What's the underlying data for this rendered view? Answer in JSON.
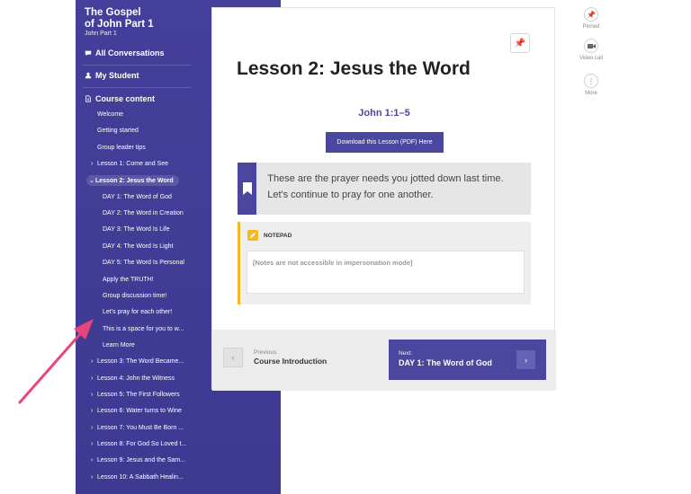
{
  "sidebar": {
    "course_title_line1": "The Gospel",
    "course_title_line2": "of John Part 1",
    "course_subtitle": "John Part 1",
    "all_conversations": "All Conversations",
    "my_student": "My Student",
    "course_content": "Course content",
    "items": [
      {
        "label": "Welcome",
        "chev": ""
      },
      {
        "label": "Getting started",
        "chev": ""
      },
      {
        "label": "Group leader tips",
        "chev": ""
      },
      {
        "label": "Lesson 1: Come and See",
        "chev": "›"
      },
      {
        "label": "Lesson 2: Jesus the Word",
        "chev": "⌄"
      },
      {
        "label": "DAY 1: The Word of God",
        "chev": ""
      },
      {
        "label": "DAY 2: The Word in Creation",
        "chev": ""
      },
      {
        "label": "DAY 3: The Word Is Life",
        "chev": ""
      },
      {
        "label": "DAY 4: The Word Is Light",
        "chev": ""
      },
      {
        "label": "DAY 5: The Word Is Personal",
        "chev": ""
      },
      {
        "label": "Apply the TRUTH!",
        "chev": ""
      },
      {
        "label": "Group discussion time!",
        "chev": ""
      },
      {
        "label": "Let's pray for each other!",
        "chev": ""
      },
      {
        "label": "This is a space for you to w...",
        "chev": ""
      },
      {
        "label": "Learn More",
        "chev": ""
      },
      {
        "label": "Lesson 3: The Word Became...",
        "chev": "›"
      },
      {
        "label": "Lesson 4: John the Witness",
        "chev": "›"
      },
      {
        "label": "Lesson 5: The First Followers",
        "chev": "›"
      },
      {
        "label": "Lesson 6: Water turns to Wine",
        "chev": "›"
      },
      {
        "label": "Lesson 7: You Must Be Born ...",
        "chev": "›"
      },
      {
        "label": "Lesson 8: For God So Loved t...",
        "chev": "›"
      },
      {
        "label": "Lesson 9: Jesus and the Sam...",
        "chev": "›"
      },
      {
        "label": "Lesson 10: A Sabbath Healin...",
        "chev": "›"
      }
    ]
  },
  "main": {
    "lesson_title": "Lesson 2: Jesus the Word",
    "scripture": "John 1:1–5",
    "pdf_button": "Download this Lesson (PDF) Here",
    "prayer_text": "These are the prayer needs you jotted down last time. Let's continue to pray for one another.",
    "notepad_label": "NOTEPAD",
    "notepad_placeholder": "[Notes are not accessible in impersonation mode]",
    "prev_label": "Previous:",
    "prev_title": "Course Introduction",
    "next_label": "Next:",
    "next_title": "DAY 1: The Word of God"
  },
  "toolbar": {
    "pinned": "Pinned",
    "video_call": "Video call",
    "more": "More"
  },
  "colors": {
    "sidebar": "#443f9a",
    "accent": "#4b479e",
    "notepad": "#f5b823",
    "arrow": "#e8457a"
  }
}
